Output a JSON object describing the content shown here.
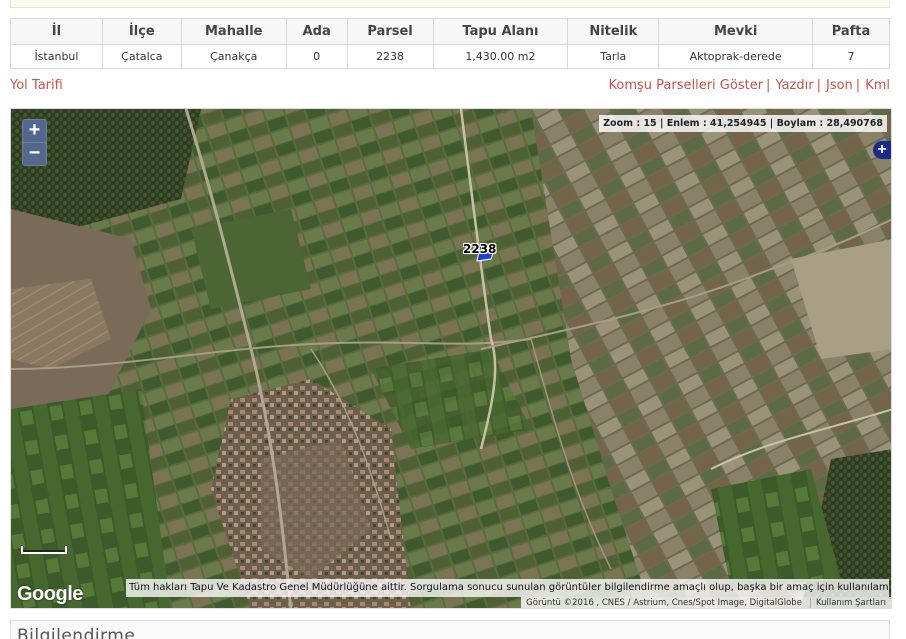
{
  "table": {
    "headers": [
      "İl",
      "İlçe",
      "Mahalle",
      "Ada",
      "Parsel",
      "Tapu Alanı",
      "Nitelik",
      "Mevki",
      "Pafta"
    ],
    "row": [
      "İstanbul",
      "Çatalca",
      "Çanakça",
      "0",
      "2238",
      "1,430.00 m2",
      "Tarla",
      "Aktoprak-derede",
      "7"
    ]
  },
  "links": {
    "directions": "Yol Tarifi",
    "neighbors": "Komşu Parselleri Göster",
    "print": "Yazdır",
    "json": "Json",
    "kml": "Kml",
    "separator": "|"
  },
  "map": {
    "zoom_in": "+",
    "zoom_out": "−",
    "coord_readout": "Zoom : 15 | Enlem : 41,254945 | Boylam : 28,490768",
    "layer_toggle": "+",
    "parcel_label": "2238",
    "google_logo": "Google",
    "notice": "Tüm hakları Tapu Ve Kadastro Genel Müdürlüğüne aittir. Sorgulama sonucu sunulan görüntüler bilgilendirme amaçlı olup, başka bir amaç için kullanılamaz.",
    "attribution": "Görüntü ©2016 , CNES / Astrium, Cnes/Spot Image, DigitalGlobe",
    "terms": "Kullanım Şartları",
    "parcel_color": "#1b3fd0",
    "link_color": "#c9524b"
  },
  "info_section": {
    "title": "Bilgilendirme"
  }
}
